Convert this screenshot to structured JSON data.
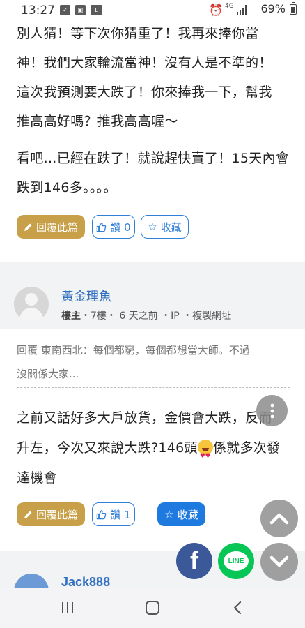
{
  "status_bar": {
    "time": "13:27",
    "network": "4G",
    "battery": "69%",
    "battery_level": 0.69,
    "icons": [
      "check-icon",
      "image-icon",
      "line-app-icon",
      "alarm-icon",
      "signal-icon",
      "battery-icon"
    ]
  },
  "post1": {
    "paragraph1": [
      "別人猜！等下次你猜重了！我再來捧你當",
      "神！我們大家輪流當神！沒有人是不準的！",
      "這次我預測要大跌了！你來捧我一下，幫我",
      "推高高好嗎？推我高高喔～"
    ],
    "paragraph2": [
      "看吧...已經在跌了！就說趕快賣了！15天內會",
      "跌到146多。。。。"
    ],
    "reply_label": "回覆此篇",
    "like_label": "讚 0",
    "fav_label": "收藏"
  },
  "post2": {
    "author_name": "黃金理魚",
    "author_role": "樓主",
    "meta": "・7樓・ 6 天之前 ・IP ・複製網址",
    "quote": [
      "回覆 東南西北：每個都窮，每個都想當大師。不過",
      "沒關係大家..."
    ],
    "body": [
      "之前又話好多大戶放貨，金價會大跌，反而",
      "升左，今次又來說大跌?146頭",
      "達機會"
    ],
    "body_after_emoji": "係就多次發",
    "reply_label": "回覆此篇",
    "like_label": "讚 1",
    "fav_label": "收藏"
  },
  "next_post": {
    "author_name": "Jack888"
  },
  "share": {
    "facebook_glyph": "f",
    "line_glyph": "LINE"
  },
  "colors": {
    "reply_gold": "#c9a04a",
    "link_blue": "#2f6fbf",
    "button_blue": "#1f7ae0",
    "facebook": "#3b5998",
    "line_green": "#06c755"
  }
}
